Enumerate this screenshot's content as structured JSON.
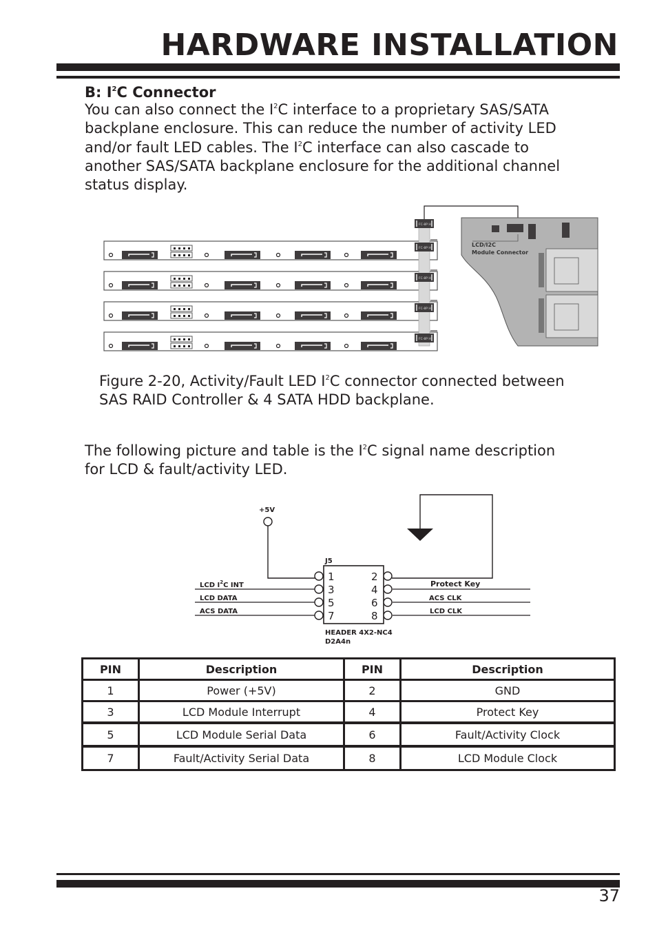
{
  "header": {
    "title": "HARDWARE INSTALLATION"
  },
  "section": {
    "heading_prefix": "B: I",
    "heading_sup": "2",
    "heading_suffix": "C Connector",
    "paragraph_lines": [
      [
        "You can also connect the I",
        "2",
        "C interface to a proprietary SAS/SATA"
      ],
      [
        "backplane enclosure. This can reduce the number of activity LED"
      ],
      [
        "and/or fault LED cables. The I",
        "2",
        "C interface can also cascade to"
      ],
      [
        "another SAS/SATA backplane enclosure for the additional channel"
      ],
      [
        "status display."
      ]
    ]
  },
  "figure1": {
    "connector_label": "FC-8P H",
    "controller_label_line1": "LCD/I2C",
    "controller_label_line2": "Module Connector",
    "caption_line1_a": "Figure 2-20, Activity/Fault LED I",
    "caption_line1_sup": "2",
    "caption_line1_b": "C connector connected between",
    "caption_line2": "SAS RAID Controller & 4 SATA HDD backplane."
  },
  "intro2": {
    "line1_a": "The following picture and table is the I",
    "line1_sup": "2",
    "line1_b": "C signal name description",
    "line2": "for LCD & fault/activity LED."
  },
  "schematic": {
    "power_label": "+5V",
    "ref_designator": "J5",
    "part_line1": "HEADER 4X2-NC4",
    "part_line2": "D2A4n",
    "pins_left": [
      "1",
      "3",
      "5",
      "7"
    ],
    "pins_right": [
      "2",
      "4",
      "6",
      "8"
    ],
    "signal_pin3_a": "LCD I",
    "signal_pin3_sup": "2",
    "signal_pin3_b": "C INT",
    "signal_pin5": "LCD DATA",
    "signal_pin7": "ACS DATA",
    "signal_pin4": "Protect Key",
    "signal_pin6": "ACS CLK",
    "signal_pin8": "LCD CLK"
  },
  "pin_table": {
    "headers": [
      "PIN",
      "Description",
      "PIN",
      "Description"
    ],
    "rows": [
      [
        "1",
        "Power (+5V)",
        "2",
        "GND"
      ],
      [
        "3",
        "LCD Module Interrupt",
        "4",
        "Protect Key"
      ],
      [
        "5",
        "LCD Module Serial Data",
        "6",
        "Fault/Activity Clock"
      ],
      [
        "7",
        "Fault/Activity Serial Data",
        "8",
        "LCD Module Clock"
      ]
    ]
  },
  "footer": {
    "page_number": "37"
  },
  "colors": {
    "ink": "#231f20",
    "board_gray": "#b3b3b3",
    "connector_dark": "#3f3c3d",
    "cable_gray": "#d9d9d9"
  }
}
